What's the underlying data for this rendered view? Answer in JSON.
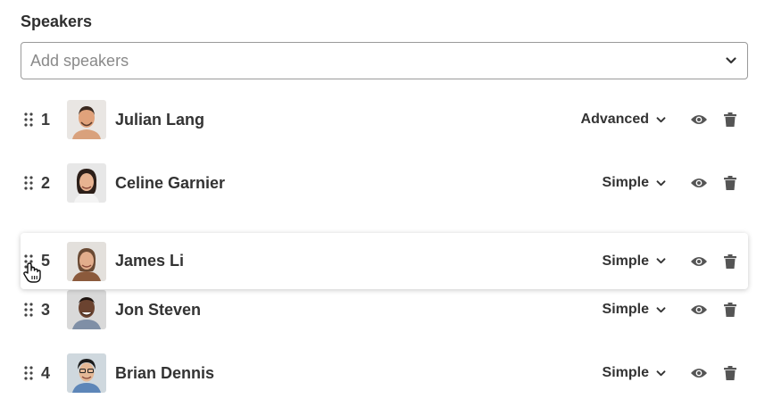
{
  "section_title": "Speakers",
  "add_speakers": {
    "placeholder": "Add speakers"
  },
  "speakers": [
    {
      "order": "1",
      "name": "Julian Lang",
      "mode": "Advanced"
    },
    {
      "order": "2",
      "name": "Celine Garnier",
      "mode": "Simple"
    },
    {
      "order": "5",
      "name": "James Li",
      "mode": "Simple"
    },
    {
      "order": "3",
      "name": "Jon Steven",
      "mode": "Simple"
    },
    {
      "order": "4",
      "name": "Brian Dennis",
      "mode": "Simple"
    }
  ],
  "icons": {
    "drag_handle": "drag-handle-icon",
    "dropdown": "chevron-down-icon",
    "preview": "eye-icon",
    "delete": "trash-icon",
    "cursor": "grab-hand-cursor"
  },
  "colors": {
    "text": "#333333",
    "placeholder": "#8a8a8a",
    "border": "#9a9a9a",
    "icon": "#555555"
  }
}
